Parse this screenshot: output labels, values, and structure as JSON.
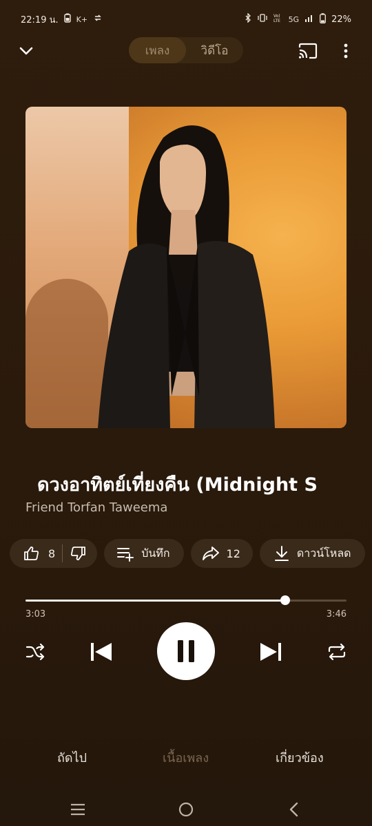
{
  "status_bar": {
    "time": "22:19 น.",
    "left_glyphs": "K+",
    "network": "5G",
    "battery": "22%"
  },
  "top_bar": {
    "tabs": [
      {
        "label": "เพลง",
        "active": true
      },
      {
        "label": "วิดีโอ",
        "active": false
      }
    ]
  },
  "song": {
    "title": "ดวงอาทิตย์เที่ยงคืน (Midnight S",
    "artist": "Friend Torfan Taweema"
  },
  "actions": {
    "like_count": "8",
    "save_label": "บันทึก",
    "share_count": "12",
    "download_label": "ดาวน์โหลด"
  },
  "player": {
    "elapsed": "3:03",
    "duration": "3:46",
    "progress_fraction": 0.81
  },
  "bottom_tabs": {
    "next": "ถัดไป",
    "lyrics": "เนื้อเพลง",
    "related": "เกี่ยวข้อง"
  },
  "colors": {
    "background": "#2a1a0c",
    "pill": "#3a2a1a",
    "artwork_orange": "#e99a36",
    "dim_tab": "#7a6650"
  }
}
